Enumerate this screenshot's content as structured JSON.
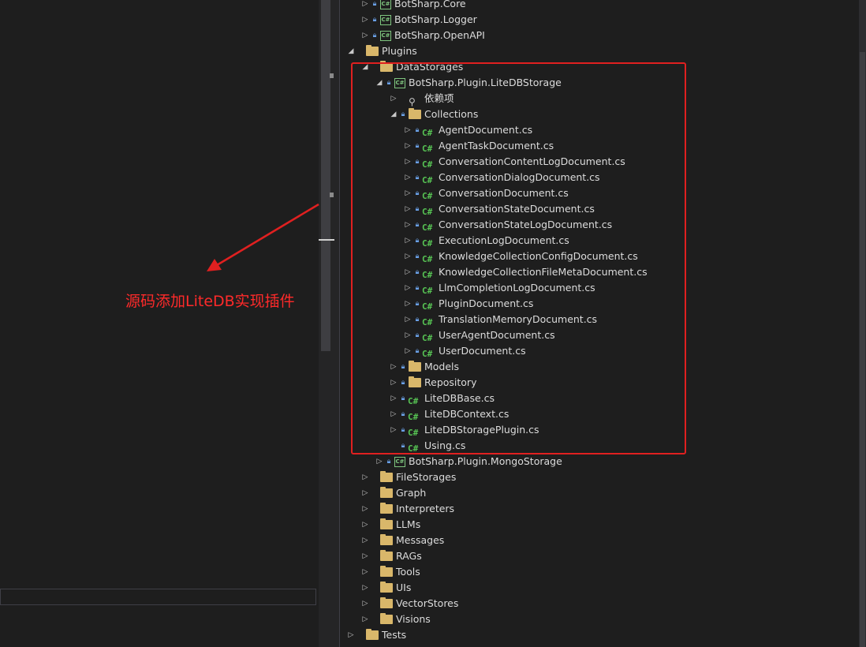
{
  "annotation": {
    "text": "源码添加LiteDB实现插件",
    "color": "#ff2a2a"
  },
  "colors": {
    "background": "#1e1e1e",
    "highlight": "#e02020",
    "csharp": "#57c454",
    "folder": "#d9b76a",
    "lock": "#6aa0e6"
  },
  "tree": [
    {
      "label": "BotSharp.Core",
      "icon": "csharp-project-icon",
      "expander": "collapsed",
      "lock": true
    },
    {
      "label": "BotSharp.Logger",
      "icon": "csharp-project-icon",
      "expander": "collapsed",
      "lock": true
    },
    {
      "label": "BotSharp.OpenAPI",
      "icon": "csharp-project-icon",
      "expander": "collapsed",
      "lock": true
    },
    {
      "label": "Plugins",
      "icon": "folder-icon",
      "expander": "expanded",
      "lock": false
    },
    {
      "label": "DataStorages",
      "icon": "folder-icon",
      "expander": "expanded",
      "lock": false
    },
    {
      "label": "BotSharp.Plugin.LiteDBStorage",
      "icon": "csharp-project-icon",
      "expander": "expanded",
      "lock": true
    },
    {
      "label": "依赖项",
      "icon": "dependencies-icon",
      "expander": "collapsed",
      "lock": false
    },
    {
      "label": "Collections",
      "icon": "folder-icon",
      "expander": "expanded",
      "lock": true
    },
    {
      "label": "AgentDocument.cs",
      "icon": "csharp-file-icon",
      "expander": "collapsed",
      "lock": true
    },
    {
      "label": "AgentTaskDocument.cs",
      "icon": "csharp-file-icon",
      "expander": "collapsed",
      "lock": true
    },
    {
      "label": "ConversationContentLogDocument.cs",
      "icon": "csharp-file-icon",
      "expander": "collapsed",
      "lock": true
    },
    {
      "label": "ConversationDialogDocument.cs",
      "icon": "csharp-file-icon",
      "expander": "collapsed",
      "lock": true
    },
    {
      "label": "ConversationDocument.cs",
      "icon": "csharp-file-icon",
      "expander": "collapsed",
      "lock": true
    },
    {
      "label": "ConversationStateDocument.cs",
      "icon": "csharp-file-icon",
      "expander": "collapsed",
      "lock": true
    },
    {
      "label": "ConversationStateLogDocument.cs",
      "icon": "csharp-file-icon",
      "expander": "collapsed",
      "lock": true
    },
    {
      "label": "ExecutionLogDocument.cs",
      "icon": "csharp-file-icon",
      "expander": "collapsed",
      "lock": true
    },
    {
      "label": "KnowledgeCollectionConfigDocument.cs",
      "icon": "csharp-file-icon",
      "expander": "collapsed",
      "lock": true
    },
    {
      "label": "KnowledgeCollectionFileMetaDocument.cs",
      "icon": "csharp-file-icon",
      "expander": "collapsed",
      "lock": true
    },
    {
      "label": "LlmCompletionLogDocument.cs",
      "icon": "csharp-file-icon",
      "expander": "collapsed",
      "lock": true
    },
    {
      "label": "PluginDocument.cs",
      "icon": "csharp-file-icon",
      "expander": "collapsed",
      "lock": true
    },
    {
      "label": "TranslationMemoryDocument.cs",
      "icon": "csharp-file-icon",
      "expander": "collapsed",
      "lock": true
    },
    {
      "label": "UserAgentDocument.cs",
      "icon": "csharp-file-icon",
      "expander": "collapsed",
      "lock": true
    },
    {
      "label": "UserDocument.cs",
      "icon": "csharp-file-icon",
      "expander": "collapsed",
      "lock": true
    },
    {
      "label": "Models",
      "icon": "folder-icon",
      "expander": "collapsed",
      "lock": true
    },
    {
      "label": "Repository",
      "icon": "folder-icon",
      "expander": "collapsed",
      "lock": true
    },
    {
      "label": "LiteDBBase.cs",
      "icon": "csharp-file-icon",
      "expander": "collapsed",
      "lock": true
    },
    {
      "label": "LiteDBContext.cs",
      "icon": "csharp-file-icon",
      "expander": "collapsed",
      "lock": true
    },
    {
      "label": "LiteDBStoragePlugin.cs",
      "icon": "csharp-file-icon",
      "expander": "collapsed",
      "lock": true
    },
    {
      "label": "Using.cs",
      "icon": "csharp-file-icon",
      "expander": "none",
      "lock": true
    },
    {
      "label": "BotSharp.Plugin.MongoStorage",
      "icon": "csharp-project-icon",
      "expander": "collapsed",
      "lock": true
    },
    {
      "label": "FileStorages",
      "icon": "folder-icon",
      "expander": "collapsed",
      "lock": false
    },
    {
      "label": "Graph",
      "icon": "folder-icon",
      "expander": "collapsed",
      "lock": false
    },
    {
      "label": "Interpreters",
      "icon": "folder-icon",
      "expander": "collapsed",
      "lock": false
    },
    {
      "label": "LLMs",
      "icon": "folder-icon",
      "expander": "collapsed",
      "lock": false
    },
    {
      "label": "Messages",
      "icon": "folder-icon",
      "expander": "collapsed",
      "lock": false
    },
    {
      "label": "RAGs",
      "icon": "folder-icon",
      "expander": "collapsed",
      "lock": false
    },
    {
      "label": "Tools",
      "icon": "folder-icon",
      "expander": "collapsed",
      "lock": false
    },
    {
      "label": "UIs",
      "icon": "folder-icon",
      "expander": "collapsed",
      "lock": false
    },
    {
      "label": "VectorStores",
      "icon": "folder-icon",
      "expander": "collapsed",
      "lock": false
    },
    {
      "label": "Visions",
      "icon": "folder-icon",
      "expander": "collapsed",
      "lock": false
    },
    {
      "label": "Tests",
      "icon": "folder-icon",
      "expander": "collapsed",
      "lock": false
    }
  ]
}
